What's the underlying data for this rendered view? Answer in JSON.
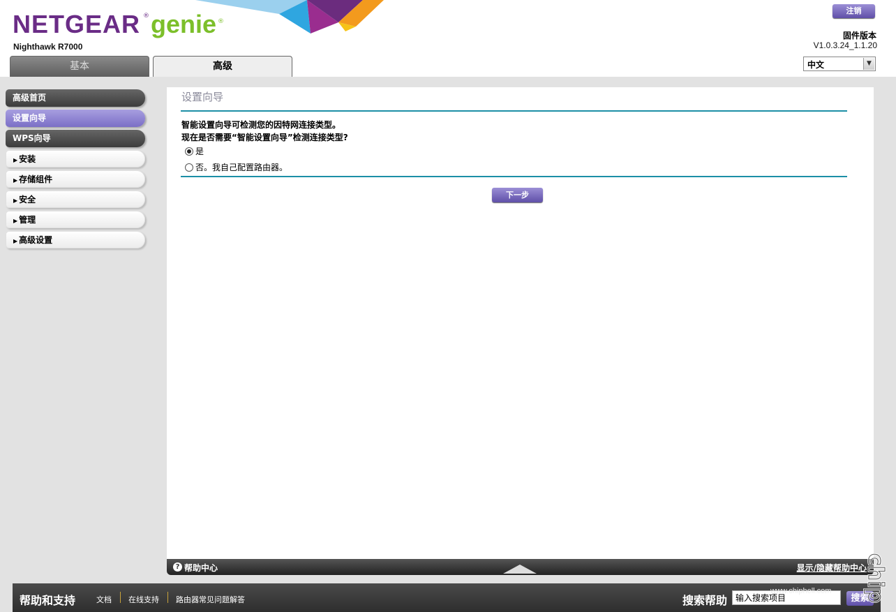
{
  "header": {
    "brand": "NETGEAR",
    "product": "genie",
    "model": "Nighthawk R7000",
    "logout_label": "注销",
    "firmware_label": "固件版本",
    "firmware_version": "V1.0.3.24_1.1.20",
    "language": {
      "selected": "中文"
    }
  },
  "tabs": [
    {
      "label": "基本",
      "active": false
    },
    {
      "label": "高级",
      "active": true
    }
  ],
  "sidebar": {
    "items": [
      {
        "label": "高级首页",
        "style": "dark"
      },
      {
        "label": "设置向导",
        "style": "active"
      },
      {
        "label": "WPS向导",
        "style": "dark"
      },
      {
        "label": "安装",
        "style": "collapsible"
      },
      {
        "label": "存储组件",
        "style": "collapsible"
      },
      {
        "label": "安全",
        "style": "collapsible"
      },
      {
        "label": "管理",
        "style": "collapsible"
      },
      {
        "label": "高级设置",
        "style": "collapsible"
      }
    ]
  },
  "main": {
    "title": "设置向导",
    "description_line1": "智能设置向导可检测您的因特网连接类型。",
    "description_line2": "现在是否需要“智能设置向导”检测连接类型?",
    "options": [
      {
        "label": "是",
        "checked": true
      },
      {
        "label": "否。我自己配置路由器。",
        "checked": false
      }
    ],
    "next_label": "下一步"
  },
  "help_bar": {
    "title": "帮助中心",
    "toggle_label": "显示/隐藏帮助中心"
  },
  "footer": {
    "title": "帮助和支持",
    "links": [
      "文档",
      "在线支持",
      "路由器常见问题解答"
    ],
    "search_label": "搜索帮助",
    "search_placeholder": "输入搜索项目",
    "search_button": "搜索"
  },
  "watermark": {
    "url": "www.chiphell.com",
    "logo_text": "chip hell"
  },
  "colors": {
    "brand_purple": "#6a2c86",
    "brand_green": "#7cbf2a",
    "accent_button": "#7b6fc6",
    "rule_teal": "#1c8fa6"
  }
}
